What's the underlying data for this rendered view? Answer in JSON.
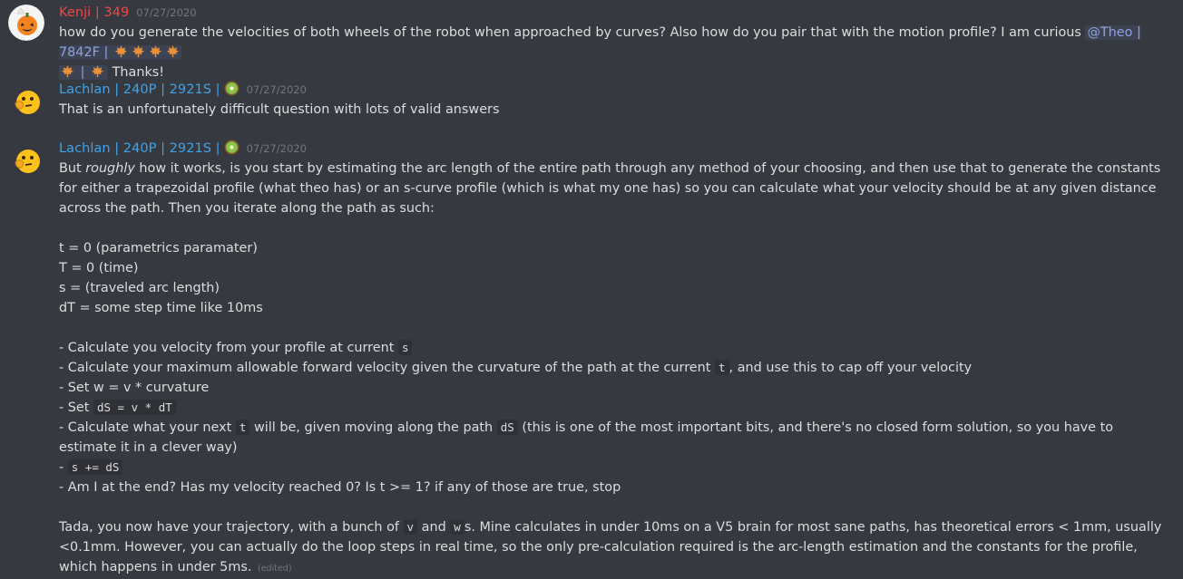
{
  "colors": {
    "background": "#36393f",
    "kenji_name": "#f04747",
    "lachlan_name": "#3ea3e8",
    "mention": "#8ea1e1",
    "timestamp": "#72767d"
  },
  "icons": {
    "leaf": "maple-leaf-icon",
    "badge": "kiwi-emoji-icon"
  },
  "messages": [
    {
      "author": "Kenji | 349",
      "timestamp": "07/27/2020",
      "text_a": "how do you generate the velocities of both wheels of the robot when approached by curves? Also how do you pair that with the motion profile? I am curious ",
      "mention_prefix": "@Theo | 7842F |",
      "mention_suffix": "|",
      "text_b": " Thanks!"
    },
    {
      "author": "Lachlan | 240P | 2921S |",
      "timestamp": "07/27/2020",
      "text": "That is an unfortunately difficult question with lots of valid answers"
    },
    {
      "author": "Lachlan | 240P | 2921S |",
      "timestamp": "07/27/2020",
      "intro_a": "But ",
      "intro_em": "roughly",
      "intro_b": " how it works, is you start by estimating the arc length of the entire path through any method of your choosing, and then use that to generate the constants for either a trapezoidal profile (what theo has) or an s-curve profile (which is what my one has) so you can calculate what your velocity should be at any given distance across the path. Then you iterate along the path as such:",
      "defs": [
        "t = 0 (parametrics paramater)",
        "T = 0 (time)",
        "s = (traveled arc length)",
        "dT = some step time like 10ms"
      ],
      "steps": {
        "s1_text": " - Calculate you velocity from your profile at current ",
        "s1_code": "s",
        "s2_text_a": " - Calculate your maximum allowable forward velocity given the curvature of the path at the current ",
        "s2_code": "t",
        "s2_text_b": ", and use this to cap off your velocity",
        "s3_text": " - Set w = v * curvature",
        "s4_text": " - Set ",
        "s4_code": "dS = v * dT",
        "s5_text_a": " - Calculate what your next ",
        "s5_code_a": "t",
        "s5_text_b": " will be, given moving along the path ",
        "s5_code_b": "dS",
        "s5_text_c": " (this is one of the most important bits, and there's no closed form solution, so you have to estimate it in a clever way)",
        "s6_text": " - ",
        "s6_code": "s += dS",
        "s7_text": " - Am I at the end? Has my velocity reached 0? Is t >= 1? if any of those are true, stop"
      },
      "outro_a": "Tada, you now have your trajectory, with a bunch of ",
      "outro_code_v": "v",
      "outro_and": " and ",
      "outro_code_w": "w",
      "outro_b": "s. Mine calculates in under 10ms on a V5 brain for most sane paths, has theoretical errors < 1mm, usually <0.1mm. However, you can actually do the loop steps in real time, so the only pre-calculation required is the arc-length estimation and the constants for the profile, which happens in under 5ms.",
      "edited": "(edited)"
    }
  ]
}
